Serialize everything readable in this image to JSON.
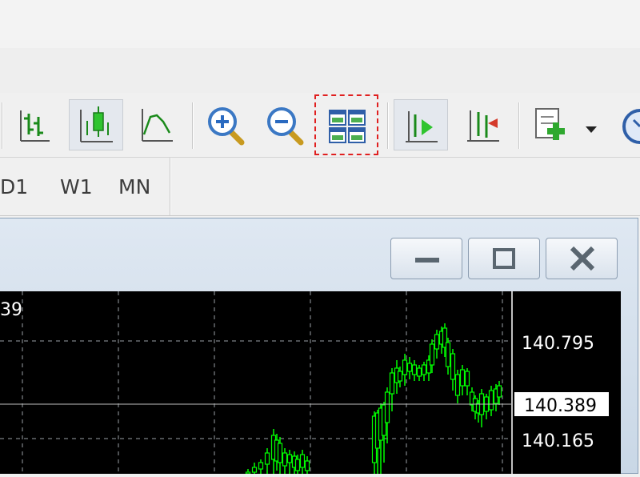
{
  "toolbar": {
    "buttons": [
      {
        "name": "bar-chart-button",
        "icon": "bar-chart-icon"
      },
      {
        "name": "candlestick-button",
        "icon": "candlestick-icon",
        "pressed": true
      },
      {
        "name": "line-chart-button",
        "icon": "line-chart-icon"
      },
      {
        "name": "zoom-in-button",
        "icon": "zoom-in-icon"
      },
      {
        "name": "zoom-out-button",
        "icon": "zoom-out-icon"
      },
      {
        "name": "tile-windows-button",
        "icon": "tile-windows-icon",
        "highlighted": true
      },
      {
        "name": "auto-scroll-button",
        "icon": "auto-scroll-icon",
        "pressed": true
      },
      {
        "name": "chart-shift-button",
        "icon": "chart-shift-icon"
      },
      {
        "name": "indicators-button",
        "icon": "indicators-icon"
      },
      {
        "name": "periods-button",
        "icon": "clock-icon"
      }
    ]
  },
  "timeframes": [
    "D1",
    "W1",
    "MN"
  ],
  "chart_window": {
    "controls": [
      "minimize-icon",
      "restore-icon",
      "close-icon"
    ]
  },
  "chart": {
    "top_left_price_fragment": "39",
    "price_labels": [
      "140.795",
      "140.165"
    ],
    "current_price": "140.389",
    "colors": {
      "background": "#000000",
      "grid": "#9aa0a6",
      "candle": "#00ff00",
      "current_price_bg": "#ffffff"
    }
  }
}
